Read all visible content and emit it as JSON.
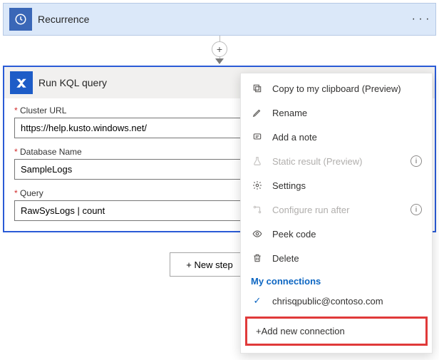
{
  "recurrence": {
    "title": "Recurrence"
  },
  "kql": {
    "title": "Run KQL query",
    "fields": {
      "cluster_label": "Cluster URL",
      "cluster_value": "https://help.kusto.windows.net/",
      "database_label": "Database Name",
      "database_value": "SampleLogs",
      "query_label": "Query",
      "query_value": "RawSysLogs | count"
    }
  },
  "toolbar": {
    "new_step_label": "+ New step"
  },
  "menu": {
    "copy": "Copy to my clipboard (Preview)",
    "rename": "Rename",
    "add_note": "Add a note",
    "static_result": "Static result (Preview)",
    "settings": "Settings",
    "configure_run_after": "Configure run after",
    "peek_code": "Peek code",
    "delete": "Delete",
    "connections_header": "My connections",
    "connection1": "chrisqpublic@contoso.com",
    "add_connection": "+Add new connection"
  }
}
